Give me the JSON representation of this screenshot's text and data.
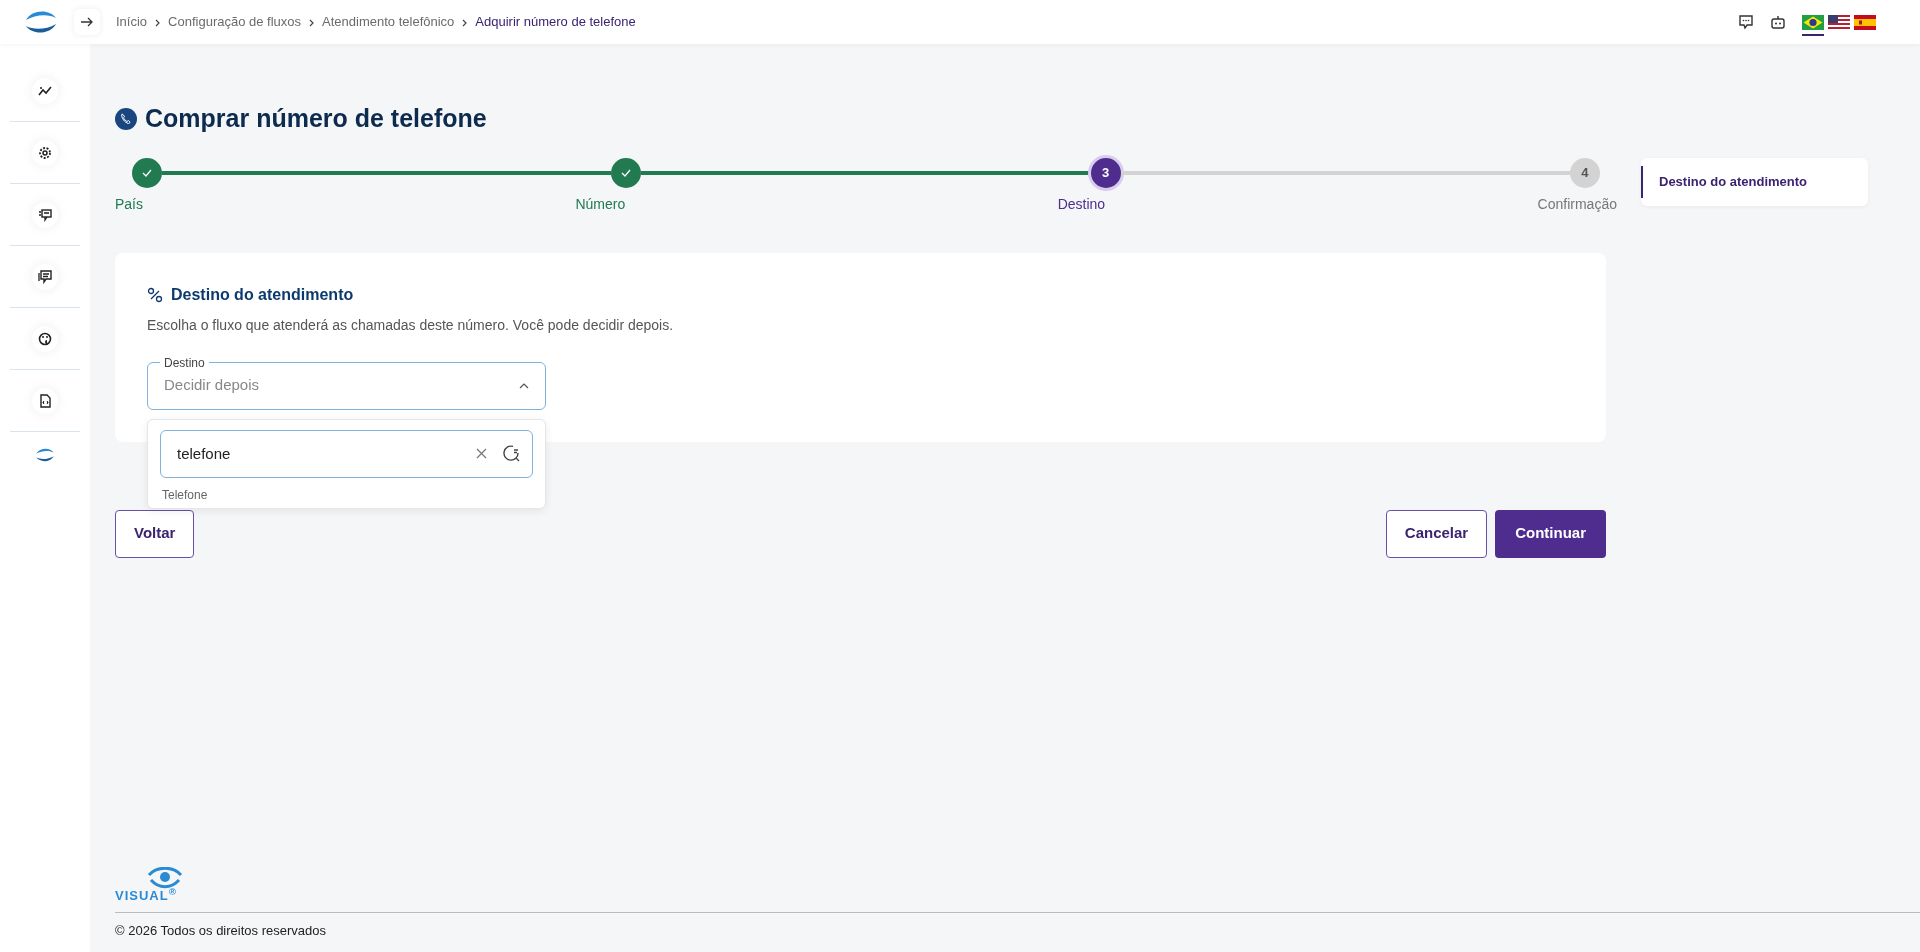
{
  "breadcrumb": [
    {
      "label": "Início",
      "current": false
    },
    {
      "label": "Configuração de fluxos",
      "current": false
    },
    {
      "label": "Atendimento telefônico",
      "current": false
    },
    {
      "label": "Adquirir número de telefone",
      "current": true
    }
  ],
  "languages": [
    {
      "kind": "br",
      "selected": true
    },
    {
      "kind": "us",
      "selected": false
    },
    {
      "kind": "es",
      "selected": false
    }
  ],
  "page_title": "Comprar número de telefone",
  "steps": [
    {
      "label": "País",
      "completed": true,
      "selected": false
    },
    {
      "label": "Número",
      "completed": true,
      "selected": false
    },
    {
      "label": "Destino",
      "completed": false,
      "selected": true,
      "number": "3"
    },
    {
      "label": "Confirmação",
      "completed": false,
      "selected": false,
      "number": "4"
    }
  ],
  "side_nav": [
    {
      "label": "Destino do atendimento",
      "selected": true
    }
  ],
  "section": {
    "title": "Destino do atendimento",
    "description": "Escolha o fluxo que atenderá as chamadas deste número. Você pode decidir depois.",
    "field": {
      "label": "Destino",
      "placeholder": "Decidir depois",
      "expanded": true,
      "search": {
        "value": "telefone"
      },
      "options": [
        {
          "label": "Telefone",
          "selected": false
        }
      ]
    }
  },
  "buttons": {
    "back": "Voltar",
    "cancel": "Cancelar",
    "continue": "Continuar"
  },
  "footer": {
    "logo": "VISUAL$^{®}$",
    "copyright": "© 2026 Todos os direitos reservados"
  }
}
